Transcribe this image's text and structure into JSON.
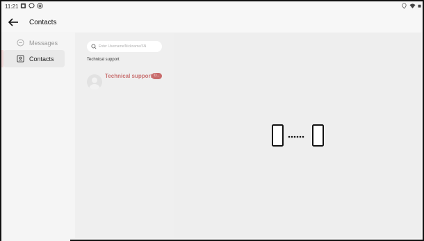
{
  "status_bar": {
    "time": "11:21",
    "left_icons": [
      "sim-card-icon",
      "chat-bubble-icon",
      "at-sign-icon"
    ],
    "right_icons": [
      "location-icon",
      "wifi-icon",
      "battery-icon"
    ]
  },
  "app_bar": {
    "back_icon": "arrow-left-icon",
    "title": "Contacts"
  },
  "sidebar": {
    "items": [
      {
        "label": "Messages",
        "icon": "chat-bubble-icon",
        "selected": false
      },
      {
        "label": "Contacts",
        "icon": "contact-card-icon",
        "selected": true
      }
    ]
  },
  "contacts_panel": {
    "search": {
      "placeholder": "Enter Username/Nickname/SN",
      "value": ""
    },
    "section_title": "Technical support",
    "contacts": [
      {
        "name": "Technical support",
        "badge": "O..."
      }
    ]
  },
  "main": {
    "empty_state_icon": "device-to-device-icon"
  },
  "colors": {
    "accent": "#c86b6b",
    "contact_name": "#c97373",
    "panel_bg": "#efefef",
    "main_bg": "#eeeeee"
  }
}
